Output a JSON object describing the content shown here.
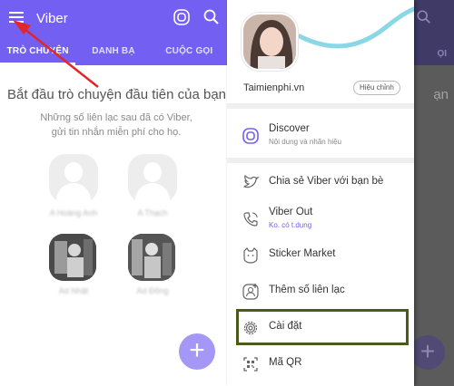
{
  "app": {
    "title": "Viber",
    "tabs": [
      {
        "label": "TRÒ CHUYỆN",
        "active": true
      },
      {
        "label": "DANH BẠ",
        "active": false
      },
      {
        "label": "CUỘC GỌI",
        "active": false
      }
    ],
    "empty_state": {
      "title": "Bắt đầu trò chuyện đầu tiên của bạn",
      "subtitle_line1": "Những số liên lạc sau đã có Viber,",
      "subtitle_line2": "gửi tin nhắn miễn phí cho họ."
    },
    "contacts": [
      {
        "name": "A Hoàng Anh"
      },
      {
        "name": "A Thạch"
      },
      {
        "name": "Ad Nhật"
      },
      {
        "name": "Ad Đông"
      }
    ],
    "fab_symbol": "+"
  },
  "overlay": {
    "tab_fragment": "ỌI",
    "text_fragment": "ạn"
  },
  "drawer": {
    "profile_name": "Taimienphi.vn",
    "edit_label": "Hiệu chỉnh",
    "items": [
      {
        "label": "Discover",
        "sub": "Nội dung và nhãn hiệu",
        "icon": "discover-icon"
      },
      {
        "label": "Chia sẻ Viber với bạn bè",
        "sub": "",
        "icon": "twitter-icon"
      },
      {
        "label": "Viber Out",
        "sub": "Ko. có t.dụng",
        "icon": "phone-icon"
      },
      {
        "label": "Sticker Market",
        "sub": "",
        "icon": "sticker-icon"
      },
      {
        "label": "Thêm số liên lạc",
        "sub": "",
        "icon": "add-contact-icon"
      },
      {
        "label": "Cài đặt",
        "sub": "",
        "icon": "gear-icon"
      },
      {
        "label": "Mã QR",
        "sub": "",
        "icon": "qr-icon"
      }
    ]
  },
  "colors": {
    "accent": "#7360f2",
    "highlight_border": "#4a5a1a",
    "arrow": "#e2262b"
  }
}
